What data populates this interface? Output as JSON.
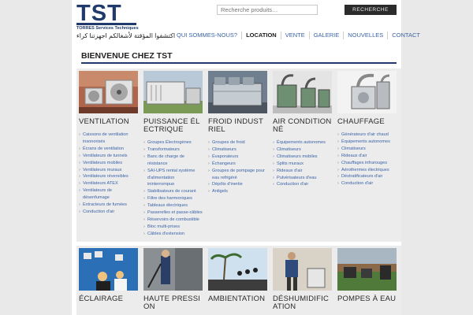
{
  "header": {
    "logo_text": "TST",
    "logo_subtitle": "TORRES Services Techniques",
    "arabic_tagline": "اكتشفوا المؤقتة لأشغالكم اجهزتنا كراء",
    "search_placeholder": "Recherche produits…",
    "search_button": "RECHERCHE"
  },
  "nav": {
    "items": [
      "QUI SOMMES-NOUS?",
      "LOCATION",
      "VENTE",
      "GALERIE",
      "NOUVELLES",
      "CONTACT"
    ],
    "active": "LOCATION"
  },
  "welcome_title": "BIENVENUE CHEZ TST",
  "categories": [
    {
      "title": "VENTILATION",
      "items": [
        "Caissons de ventilation insonorisés",
        "Écrans de ventilation",
        "Ventilateurs de tunnels",
        "Ventilateurs mobiles",
        "Ventilateurs muraux",
        "Ventilateurs réversibles",
        "Ventilateurs ATEX",
        "Ventilateurs de désenfumage",
        "Extracteurs de fumées",
        "Conduction d'air"
      ]
    },
    {
      "title": "PUISSANCE ÉLECTRIQUE",
      "items": [
        "Groupes Électrogènes",
        "Transformateurs",
        "Banc de charge de résistance",
        "SAI-UPS rental système d'alimentation ininterrompue",
        "Stabilisateurs de courant",
        "Filtre des harmoniques",
        "Tableaux électriques",
        "Passerelles et passe-câbles",
        "Réservoirs de combustible",
        "Bloc multi-prises",
        "Câbles d'extension"
      ]
    },
    {
      "title": "FROID INDUSTRIEL",
      "items": [
        "Groupes de froid",
        "Climatiseurs",
        "Évaporateurs",
        "Échangeurs",
        "Groupes de pompage pour eau refrigéré",
        "Dépôts d'inertie",
        "Antigels"
      ]
    },
    {
      "title": "AIR CONDITIONNÉ",
      "items": [
        "Équipements autonomes",
        "Climatiseurs",
        "Climatiseurs mobiles",
        "Splits muraux",
        "Rideaux d'air",
        "Pulvérisateurs d'eau",
        "Conduction d'air"
      ]
    },
    {
      "title": "CHAUFFAGE",
      "items": [
        "Générateurs d'air chaud",
        "Équipements autonomes",
        "Climatiseurs",
        "Rideaux d'air",
        "Chauffages infrarouges",
        "Aérothermes électriques",
        "Déstratificateurs d'air",
        "Conduction d'air"
      ]
    }
  ],
  "bottom_categories": [
    {
      "title": "ÉCLAIRAGE"
    },
    {
      "title": "HAUTE PRESSION"
    },
    {
      "title": "AMBIENTATION"
    },
    {
      "title": "DÉSHUMIDIFICATION"
    },
    {
      "title": "POMPES À EAU"
    }
  ]
}
